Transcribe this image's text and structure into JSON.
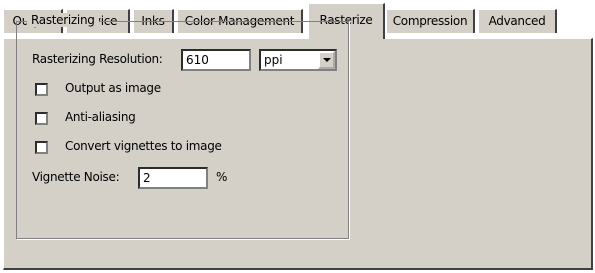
{
  "tabs": [
    {
      "label": "Output"
    },
    {
      "label": "Device"
    },
    {
      "label": "Inks"
    },
    {
      "label": "Color Management"
    },
    {
      "label": "Rasterize",
      "active": true
    },
    {
      "label": "Compression"
    },
    {
      "label": "Advanced"
    }
  ],
  "rasterizing": {
    "group_label": "Rasterizing",
    "resolution_label": "Rasterizing Resolution:",
    "resolution_value": "610",
    "unit_value": "ppi",
    "output_as_image_label": "Output as image",
    "output_as_image_checked": false,
    "anti_aliasing_label": "Anti-aliasing",
    "anti_aliasing_checked": false,
    "convert_vignettes_label": "Convert vignettes to image",
    "convert_vignettes_checked": false,
    "vignette_noise_label": "Vignette Noise:",
    "vignette_noise_value": "2",
    "vignette_noise_unit": "%"
  }
}
